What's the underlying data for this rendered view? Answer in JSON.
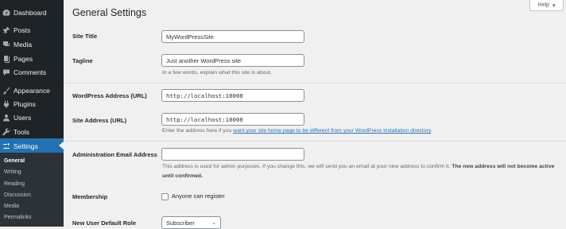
{
  "sidebar": {
    "items": [
      {
        "label": "Dashboard",
        "icon": "dashboard-icon"
      },
      {
        "label": "Posts",
        "icon": "pushpin-icon"
      },
      {
        "label": "Media",
        "icon": "media-icon"
      },
      {
        "label": "Pages",
        "icon": "pages-icon"
      },
      {
        "label": "Comments",
        "icon": "comments-icon"
      },
      {
        "label": "Appearance",
        "icon": "paintbrush-icon"
      },
      {
        "label": "Plugins",
        "icon": "plug-icon"
      },
      {
        "label": "Users",
        "icon": "users-icon"
      },
      {
        "label": "Tools",
        "icon": "wrench-icon"
      },
      {
        "label": "Settings",
        "icon": "settings-icon"
      }
    ],
    "submenu": [
      "General",
      "Writing",
      "Reading",
      "Discussion",
      "Media",
      "Permalinks"
    ]
  },
  "help": {
    "label": "Help",
    "icon": "caret-down-icon"
  },
  "page": {
    "title": "General Settings"
  },
  "fields": {
    "site_title": {
      "label": "Site Title",
      "value": "MyWordPressSite"
    },
    "tagline": {
      "label": "Tagline",
      "value": "Just another WordPress site",
      "description": "In a few words, explain what this site is about."
    },
    "wp_address": {
      "label": "WordPress Address (URL)",
      "value": "http://localhost:10008"
    },
    "site_address": {
      "label": "Site Address (URL)",
      "value": "http://localhost:10008",
      "description_prefix": "Enter the address here if you ",
      "description_link": "want your site home page to be different from your WordPress installation directory",
      "description_suffix": "."
    },
    "admin_email": {
      "label": "Administration Email Address",
      "value": "",
      "description": "This address is used for admin purposes. If you change this, we will send you an email at your new address to confirm it. ",
      "description_bold": "The new address will not become active until confirmed."
    },
    "membership": {
      "label": "Membership",
      "checkbox_label": "Anyone can register"
    },
    "default_role": {
      "label": "New User Default Role",
      "value": "Subscriber"
    }
  },
  "colors": {
    "sidebar": "#1d2327",
    "active": "#2271b1",
    "link": "#2271b1",
    "background": "#f0f0f1"
  }
}
